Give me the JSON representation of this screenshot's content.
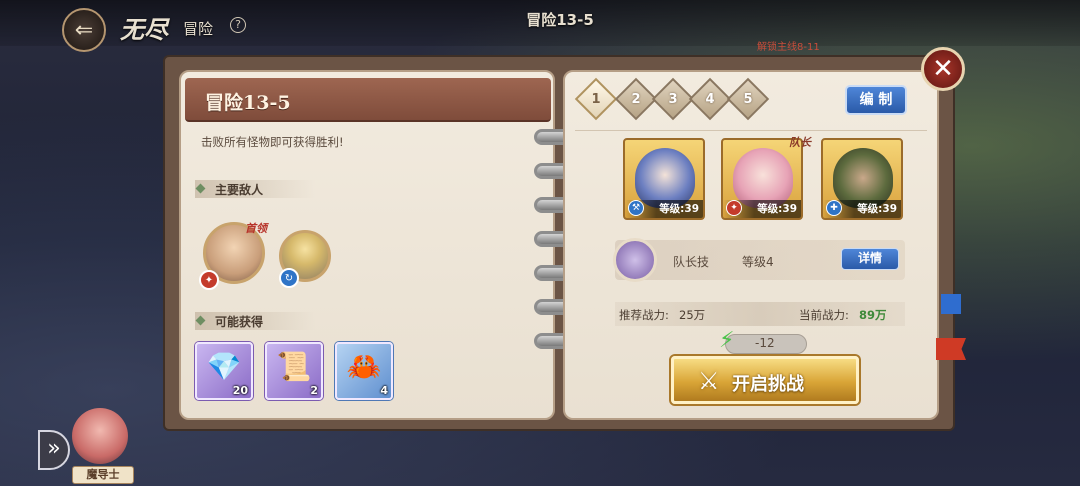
{
  "header": {
    "mode_title": "无尽",
    "mode_subtitle": "冒险",
    "help_glyph": "?",
    "stage_title": "冒险13-5",
    "unlock_hint": "解锁主线8-11",
    "back_glyph": "⇐"
  },
  "left_page": {
    "stage_name": "冒险13-5",
    "objective": "击败所有怪物即可获得胜利!",
    "enemies_heading": "主要敌人",
    "boss_tag": "首领",
    "enemies": [
      {
        "name": "boss-enemy",
        "element": "fire"
      },
      {
        "name": "minion-enemy",
        "element": "water"
      }
    ],
    "rewards_heading": "可能获得",
    "rewards": [
      {
        "icon": "diamond-icon",
        "glyph": "💎",
        "count": "20"
      },
      {
        "icon": "scroll-icon",
        "glyph": "📜",
        "count": "2"
      },
      {
        "icon": "crab-icon",
        "glyph": "🦀",
        "count": "4"
      }
    ]
  },
  "right_page": {
    "teams": [
      "1",
      "2",
      "3",
      "4",
      "5"
    ],
    "active_team": 1,
    "edit_label": "编 制",
    "captain_tag": "队长",
    "heroes": [
      {
        "level": "等级:39",
        "class_color": "#2f74c7"
      },
      {
        "level": "等级:39",
        "class_color": "#c43b2b"
      },
      {
        "level": "等级:39",
        "class_color": "#2f74c7"
      }
    ],
    "skill_label": "队长技",
    "skill_level": "等级4",
    "detail_label": "详情",
    "recommended_power_label": "推荐战力:",
    "recommended_power_value": "25万",
    "current_power_label": "当前战力:",
    "current_power_value": "89万",
    "energy_cost": "-12",
    "start_label": "开启挑战"
  },
  "bottom": {
    "character_name": "魔导士",
    "arrow_glyph": "»"
  },
  "colors": {
    "banner": "#8c5643",
    "gold_button": "#d9a537",
    "blue_button": "#3a6ec0",
    "power_green": "#3f8a3a",
    "close_red": "#a9352a"
  }
}
